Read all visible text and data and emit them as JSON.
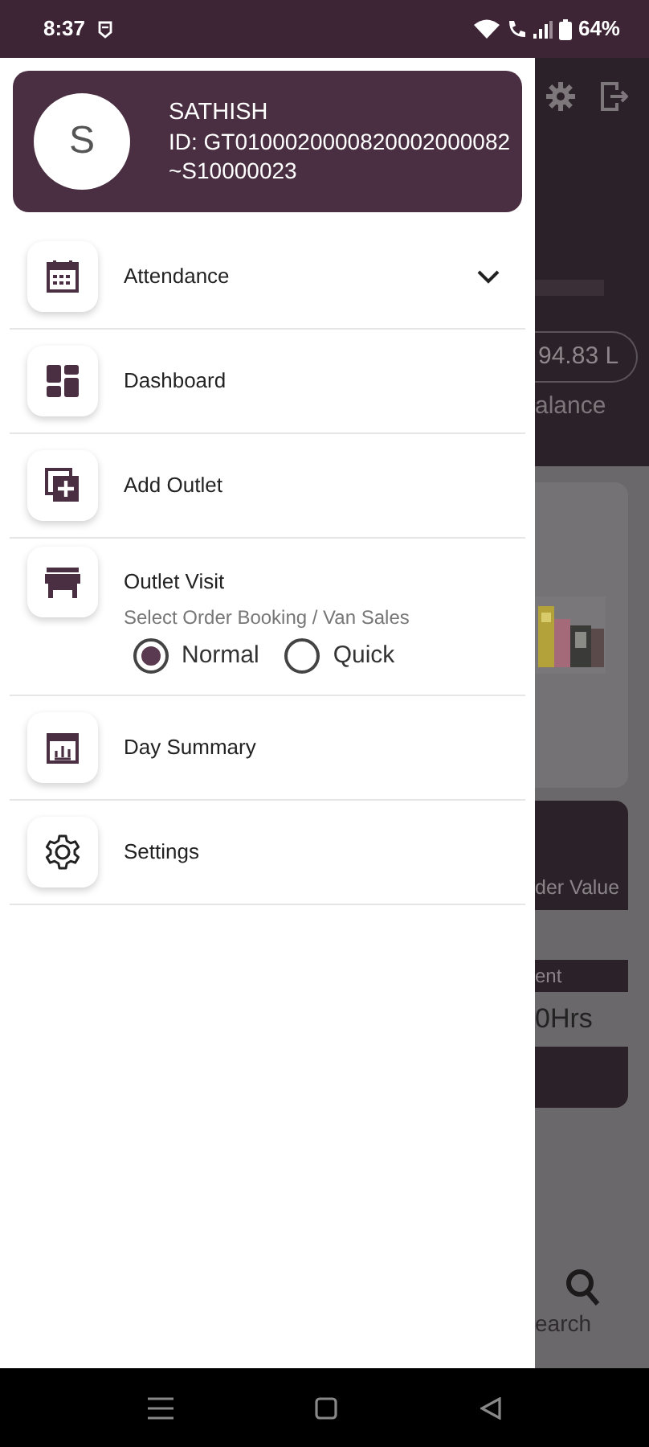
{
  "status_bar": {
    "time": "8:37",
    "battery": "64%"
  },
  "profile": {
    "avatar": "S",
    "name": "SATHISH",
    "id": "ID: GT0100020000820002000082~S10000023"
  },
  "menu": [
    {
      "kind": "expandable",
      "label": "Attendance",
      "expanded": false
    },
    {
      "kind": "link",
      "label": "Dashboard"
    },
    {
      "kind": "link",
      "label": "Add Outlet"
    },
    {
      "kind": "options",
      "label": "Outlet Visit",
      "hint": "Select Order Booking / Van Sales",
      "options": [
        {
          "label": "Normal",
          "selected": true
        },
        {
          "label": "Quick",
          "selected": false
        }
      ]
    },
    {
      "kind": "link",
      "label": "Day Summary"
    },
    {
      "kind": "link",
      "label": "Settings"
    }
  ],
  "background": {
    "amount": "94.83 L",
    "amount_caption": "alance",
    "card_caption": "der Value",
    "strip_label": "ent",
    "hours": "0Hrs",
    "search_label": "earch"
  }
}
